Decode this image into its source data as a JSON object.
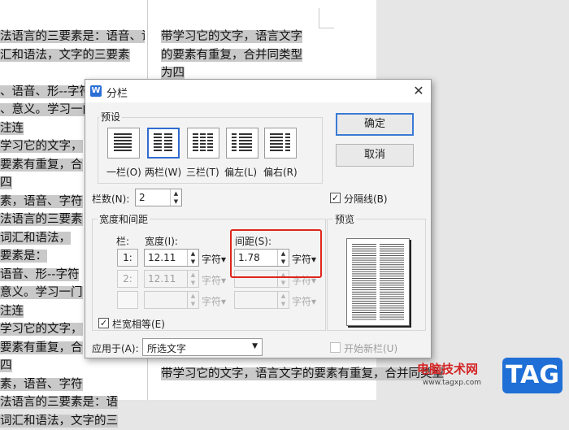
{
  "document": {
    "left_lines": [
      "法语言的三要素是：语音、词",
      "汇和语法，文字的三要素",
      "",
      "、语音、形--字符",
      "、意义。学习一门",
      "注连",
      "学习它的文字，",
      "要素有重复，合",
      "四",
      "素，语音、字符",
      "法语言的三要素",
      "词汇和语法，",
      "要素是：",
      "语音、形--字符",
      "意义。学习一门",
      "注连",
      "学习它的文字，",
      "要素有重复，合",
      "四",
      "素，语音、字符",
      "法语言的三要素是：语",
      "词汇和语法，文字的三"
    ],
    "right_lines": [
      "带学习它的文字，语言文字",
      "的要素有重复，合并同类型",
      "为四"
    ],
    "bottom_right_lines": [
      "带学习它的文字，语言文字",
      "的要素有重复，合并同类型"
    ]
  },
  "dialog": {
    "title": "分栏",
    "app_icon_letter": "W",
    "close_glyph": "✕",
    "presets_label": "预设",
    "presets": [
      {
        "label": "一栏(O)",
        "selected": false
      },
      {
        "label": "两栏(W)",
        "selected": true
      },
      {
        "label": "三栏(T)",
        "selected": false
      },
      {
        "label": "偏左(L)",
        "selected": false
      },
      {
        "label": "偏右(R)",
        "selected": false
      }
    ],
    "ok_label": "确定",
    "cancel_label": "取消",
    "columns_label": "栏数(N):",
    "columns_value": "2",
    "divider_label": "分隔线(B)",
    "divider_checked": true,
    "width_spacing_label": "宽度和间距",
    "col_header": "栏:",
    "width_header": "宽度(I):",
    "spacing_header": "间距(S):",
    "rows": [
      {
        "num": "1:",
        "width": "12.11",
        "width_unit": "字符",
        "spacing": "1.78",
        "spacing_unit": "字符",
        "enabled": true
      },
      {
        "num": "2:",
        "width": "12.11",
        "width_unit": "字符",
        "spacing": "",
        "spacing_unit": "字符",
        "enabled": false
      },
      {
        "num": "",
        "width": "",
        "width_unit": "字符",
        "spacing": "",
        "spacing_unit": "字符",
        "enabled": false
      }
    ],
    "equal_width_label": "栏宽相等(E)",
    "equal_width_checked": true,
    "preview_label": "预览",
    "apply_to_label": "应用于(A):",
    "apply_to_value": "所选文字",
    "new_column_label": "开始新栏(U)",
    "new_column_checked": false
  },
  "watermark": {
    "site_name": "电脑技术网",
    "url": "www.tagxp.com",
    "logo_text": "TAG"
  },
  "colors": {
    "accent": "#2f6bd0",
    "highlight_box": "#e0251b",
    "watermark_red": "#d42424",
    "logo_blue": "#1f6fd6"
  }
}
